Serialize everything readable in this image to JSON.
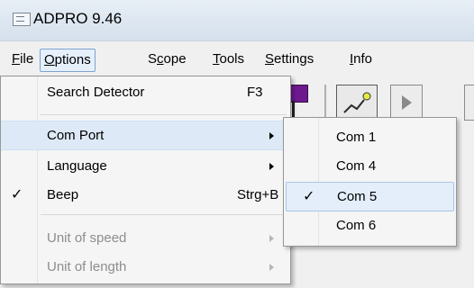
{
  "window": {
    "title": "ADPRO 9.46",
    "icon": "app-window-icon"
  },
  "menubar": {
    "items": [
      {
        "label": "File",
        "mnemonic": "F"
      },
      {
        "label": "Options",
        "mnemonic": "O"
      },
      {
        "label": "Scope",
        "mnemonic": "c"
      },
      {
        "label": "Tools",
        "mnemonic": "T"
      },
      {
        "label": "Settings",
        "mnemonic": "S"
      },
      {
        "label": "Info",
        "mnemonic": "I"
      }
    ]
  },
  "options_menu": {
    "search_detector": {
      "label": "Search Detector",
      "shortcut": "F3"
    },
    "com_port": {
      "label": "Com Port"
    },
    "language": {
      "label": "Language"
    },
    "beep": {
      "label": "Beep",
      "shortcut": "Strg+B",
      "checked": true,
      "check": "✓"
    },
    "unit_speed": {
      "label": "Unit of speed"
    },
    "unit_length": {
      "label": "Unit of length"
    }
  },
  "com_port_menu": {
    "items": [
      {
        "label": "Com 1"
      },
      {
        "label": "Com 4"
      },
      {
        "label": "Com 5",
        "checked": true,
        "check": "✓"
      },
      {
        "label": "Com 6"
      }
    ]
  },
  "colors": {
    "highlight": "#dde9f7",
    "selected_border": "#a8c6ea",
    "titlebar": "#dde6ef",
    "toolbar_purple": "#6d1a8f"
  }
}
